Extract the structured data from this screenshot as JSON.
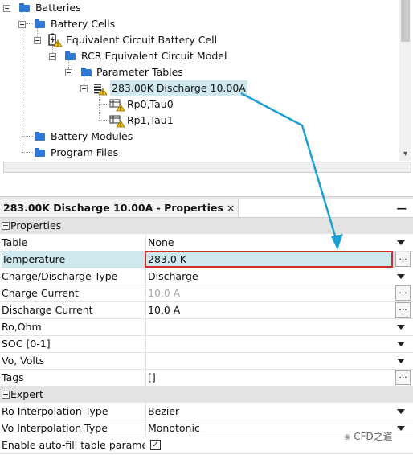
{
  "tree": {
    "nodes": [
      {
        "label": "Batteries",
        "icon": "folder-icon"
      },
      {
        "label": "Battery Cells",
        "icon": "folder-icon"
      },
      {
        "label": "Equivalent Circuit Battery Cell",
        "icon": "battery-warning-icon"
      },
      {
        "label": "RCR Equivalent Circuit Model",
        "icon": "folder-icon"
      },
      {
        "label": "Parameter Tables",
        "icon": "folder-icon"
      },
      {
        "label": "283.00K Discharge 10.00A",
        "icon": "table-warning-icon"
      },
      {
        "label": "Rp0,Tau0",
        "icon": "table-warning-icon"
      },
      {
        "label": "Rp1,Tau1",
        "icon": "table-warning-icon"
      },
      {
        "label": "Battery Modules",
        "icon": "folder-icon"
      },
      {
        "label": "Program Files",
        "icon": "folder-icon"
      }
    ]
  },
  "properties": {
    "tab_title": "283.00K Discharge 10.00A - Properties",
    "close": "×",
    "minimize": "—",
    "categories": [
      {
        "label": "Properties"
      },
      {
        "label": "Expert"
      }
    ],
    "rows": [
      {
        "name": "Table",
        "value": "None"
      },
      {
        "name": "Temperature",
        "value": "283.0 K"
      },
      {
        "name": "Charge/Discharge Type",
        "value": "Discharge"
      },
      {
        "name": "Charge Current",
        "value": "10.0 A"
      },
      {
        "name": "Discharge Current",
        "value": "10.0 A"
      },
      {
        "name": "Ro,Ohm",
        "value": ""
      },
      {
        "name": "SOC [0-1]",
        "value": ""
      },
      {
        "name": "Vo, Volts",
        "value": ""
      },
      {
        "name": "Tags",
        "value": "[]"
      },
      {
        "name": "Ro Interpolation Type",
        "value": "Bezier"
      },
      {
        "name": "Vo Interpolation Type",
        "value": "Monotonic"
      },
      {
        "name": "Enable auto-fill table parame",
        "value": "✓"
      }
    ],
    "ellipsis": "..."
  },
  "watermark": "CFD之道",
  "colors": {
    "selection": "#cfe8ee",
    "highlight_border": "#c8312e",
    "arrow": "#1e9fd4",
    "folder": "#2f7ad6"
  }
}
